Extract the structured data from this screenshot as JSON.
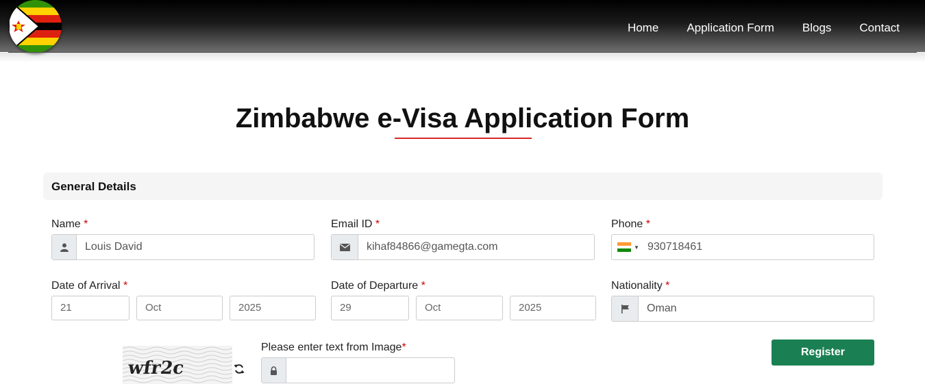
{
  "nav": {
    "items": [
      "Home",
      "Application Form",
      "Blogs",
      "Contact"
    ]
  },
  "page": {
    "title": "Zimbabwe e-Visa Application Form",
    "accent_color": "#d62828"
  },
  "section": {
    "title": "General Details"
  },
  "fields": {
    "name": {
      "label": "Name",
      "required": "*",
      "value": "Louis David",
      "icon": "user-icon"
    },
    "email": {
      "label": "Email ID",
      "required": "*",
      "value": "kihaf84866@gamegta.com",
      "icon": "envelope-icon"
    },
    "phone": {
      "label": "Phone",
      "required": "*",
      "value": "930718461",
      "icon": "india-flag-icon"
    },
    "arrival": {
      "label": "Date of Arrival",
      "required": "*",
      "day": "21",
      "month": "Oct",
      "year": "2025"
    },
    "departure": {
      "label": "Date of Departure",
      "required": "*",
      "day": "29",
      "month": "Oct",
      "year": "2025"
    },
    "nationality": {
      "label": "Nationality",
      "required": "*",
      "value": "Oman",
      "icon": "flag-icon"
    },
    "captcha": {
      "label": "Please enter text from Image",
      "required": "*",
      "image_text": "wfr2c",
      "value": "",
      "icon": "lock-icon"
    }
  },
  "actions": {
    "register_label": "Register",
    "register_color": "#1a8053"
  }
}
